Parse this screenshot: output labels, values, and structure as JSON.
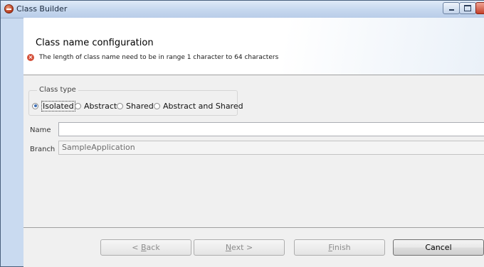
{
  "window": {
    "title": "Class Builder"
  },
  "header": {
    "title": "Class name configuration",
    "error_message": "The length of class name need to be  in range 1 character to 64 characters"
  },
  "class_type": {
    "legend": "Class type",
    "options": [
      {
        "label": "Isolated",
        "selected": true
      },
      {
        "label": "Abstract",
        "selected": false
      },
      {
        "label": "Shared",
        "selected": false
      },
      {
        "label": "Abstract and Shared",
        "selected": false
      }
    ]
  },
  "fields": {
    "name_label": "Name",
    "name_value": "",
    "branch_label": "Branch",
    "branch_value": "SampleApplication"
  },
  "buttons": {
    "back_arrow": "< ",
    "back_mnemonic": "B",
    "back_rest": "ack",
    "next_mnemonic": "N",
    "next_rest": "ext >",
    "finish_mnemonic": "F",
    "finish_rest": "inish",
    "cancel": "Cancel"
  }
}
